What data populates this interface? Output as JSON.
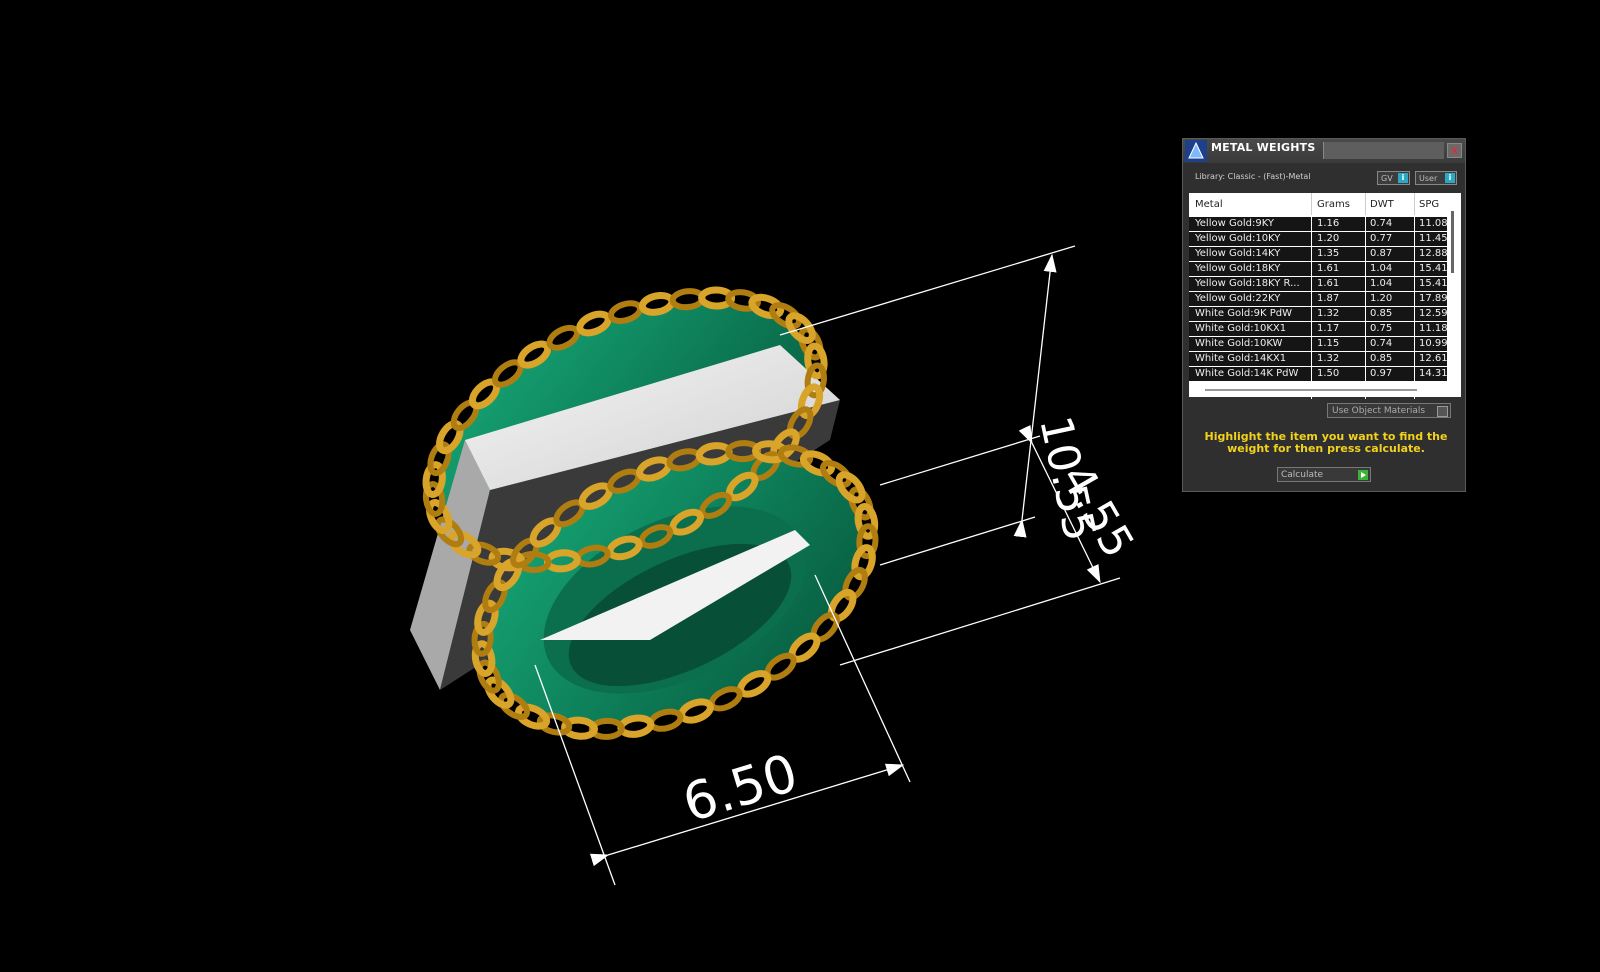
{
  "dimensions": {
    "height_upper": "10.55",
    "height_lower": "4.55",
    "width": "6.50"
  },
  "panel": {
    "title": "METAL WEIGHTS",
    "close_glyph": "x",
    "library": "Library: Classic - (Fast)-Metal",
    "gv_label": "GV",
    "user_label": "User",
    "info_glyph": "i",
    "columns": [
      "Metal",
      "Grams",
      "DWT",
      "SPG"
    ],
    "rows": [
      {
        "metal": "Yellow Gold:9KY",
        "grams": "1.16",
        "dwt": "0.74",
        "spg": "11.08"
      },
      {
        "metal": "Yellow Gold:10KY",
        "grams": "1.20",
        "dwt": "0.77",
        "spg": "11.45"
      },
      {
        "metal": "Yellow Gold:14KY",
        "grams": "1.35",
        "dwt": "0.87",
        "spg": "12.88"
      },
      {
        "metal": "Yellow Gold:18KY",
        "grams": "1.61",
        "dwt": "1.04",
        "spg": "15.41"
      },
      {
        "metal": "Yellow Gold:18KY R...",
        "grams": "1.61",
        "dwt": "1.04",
        "spg": "15.41"
      },
      {
        "metal": "Yellow Gold:22KY",
        "grams": "1.87",
        "dwt": "1.20",
        "spg": "17.89"
      },
      {
        "metal": "White Gold:9K PdW",
        "grams": "1.32",
        "dwt": "0.85",
        "spg": "12.59"
      },
      {
        "metal": "White Gold:10KX1",
        "grams": "1.17",
        "dwt": "0.75",
        "spg": "11.18"
      },
      {
        "metal": "White Gold:10KW",
        "grams": "1.15",
        "dwt": "0.74",
        "spg": "10.99"
      },
      {
        "metal": "White Gold:14KX1",
        "grams": "1.32",
        "dwt": "0.85",
        "spg": "12.61"
      },
      {
        "metal": "White Gold:14K PdW",
        "grams": "1.50",
        "dwt": "0.97",
        "spg": "14.31"
      }
    ],
    "use_object_materials": "Use Object Materials",
    "hint": "Highlight the item you want to find the weight for then press calculate.",
    "calculate_label": "Calculate"
  },
  "colors": {
    "background": "#000000",
    "chain_gold": "#c9941b",
    "band_green": "#0e8a60",
    "stone_white": "#e8e8e8",
    "hint_yellow": "#f2d21d"
  }
}
